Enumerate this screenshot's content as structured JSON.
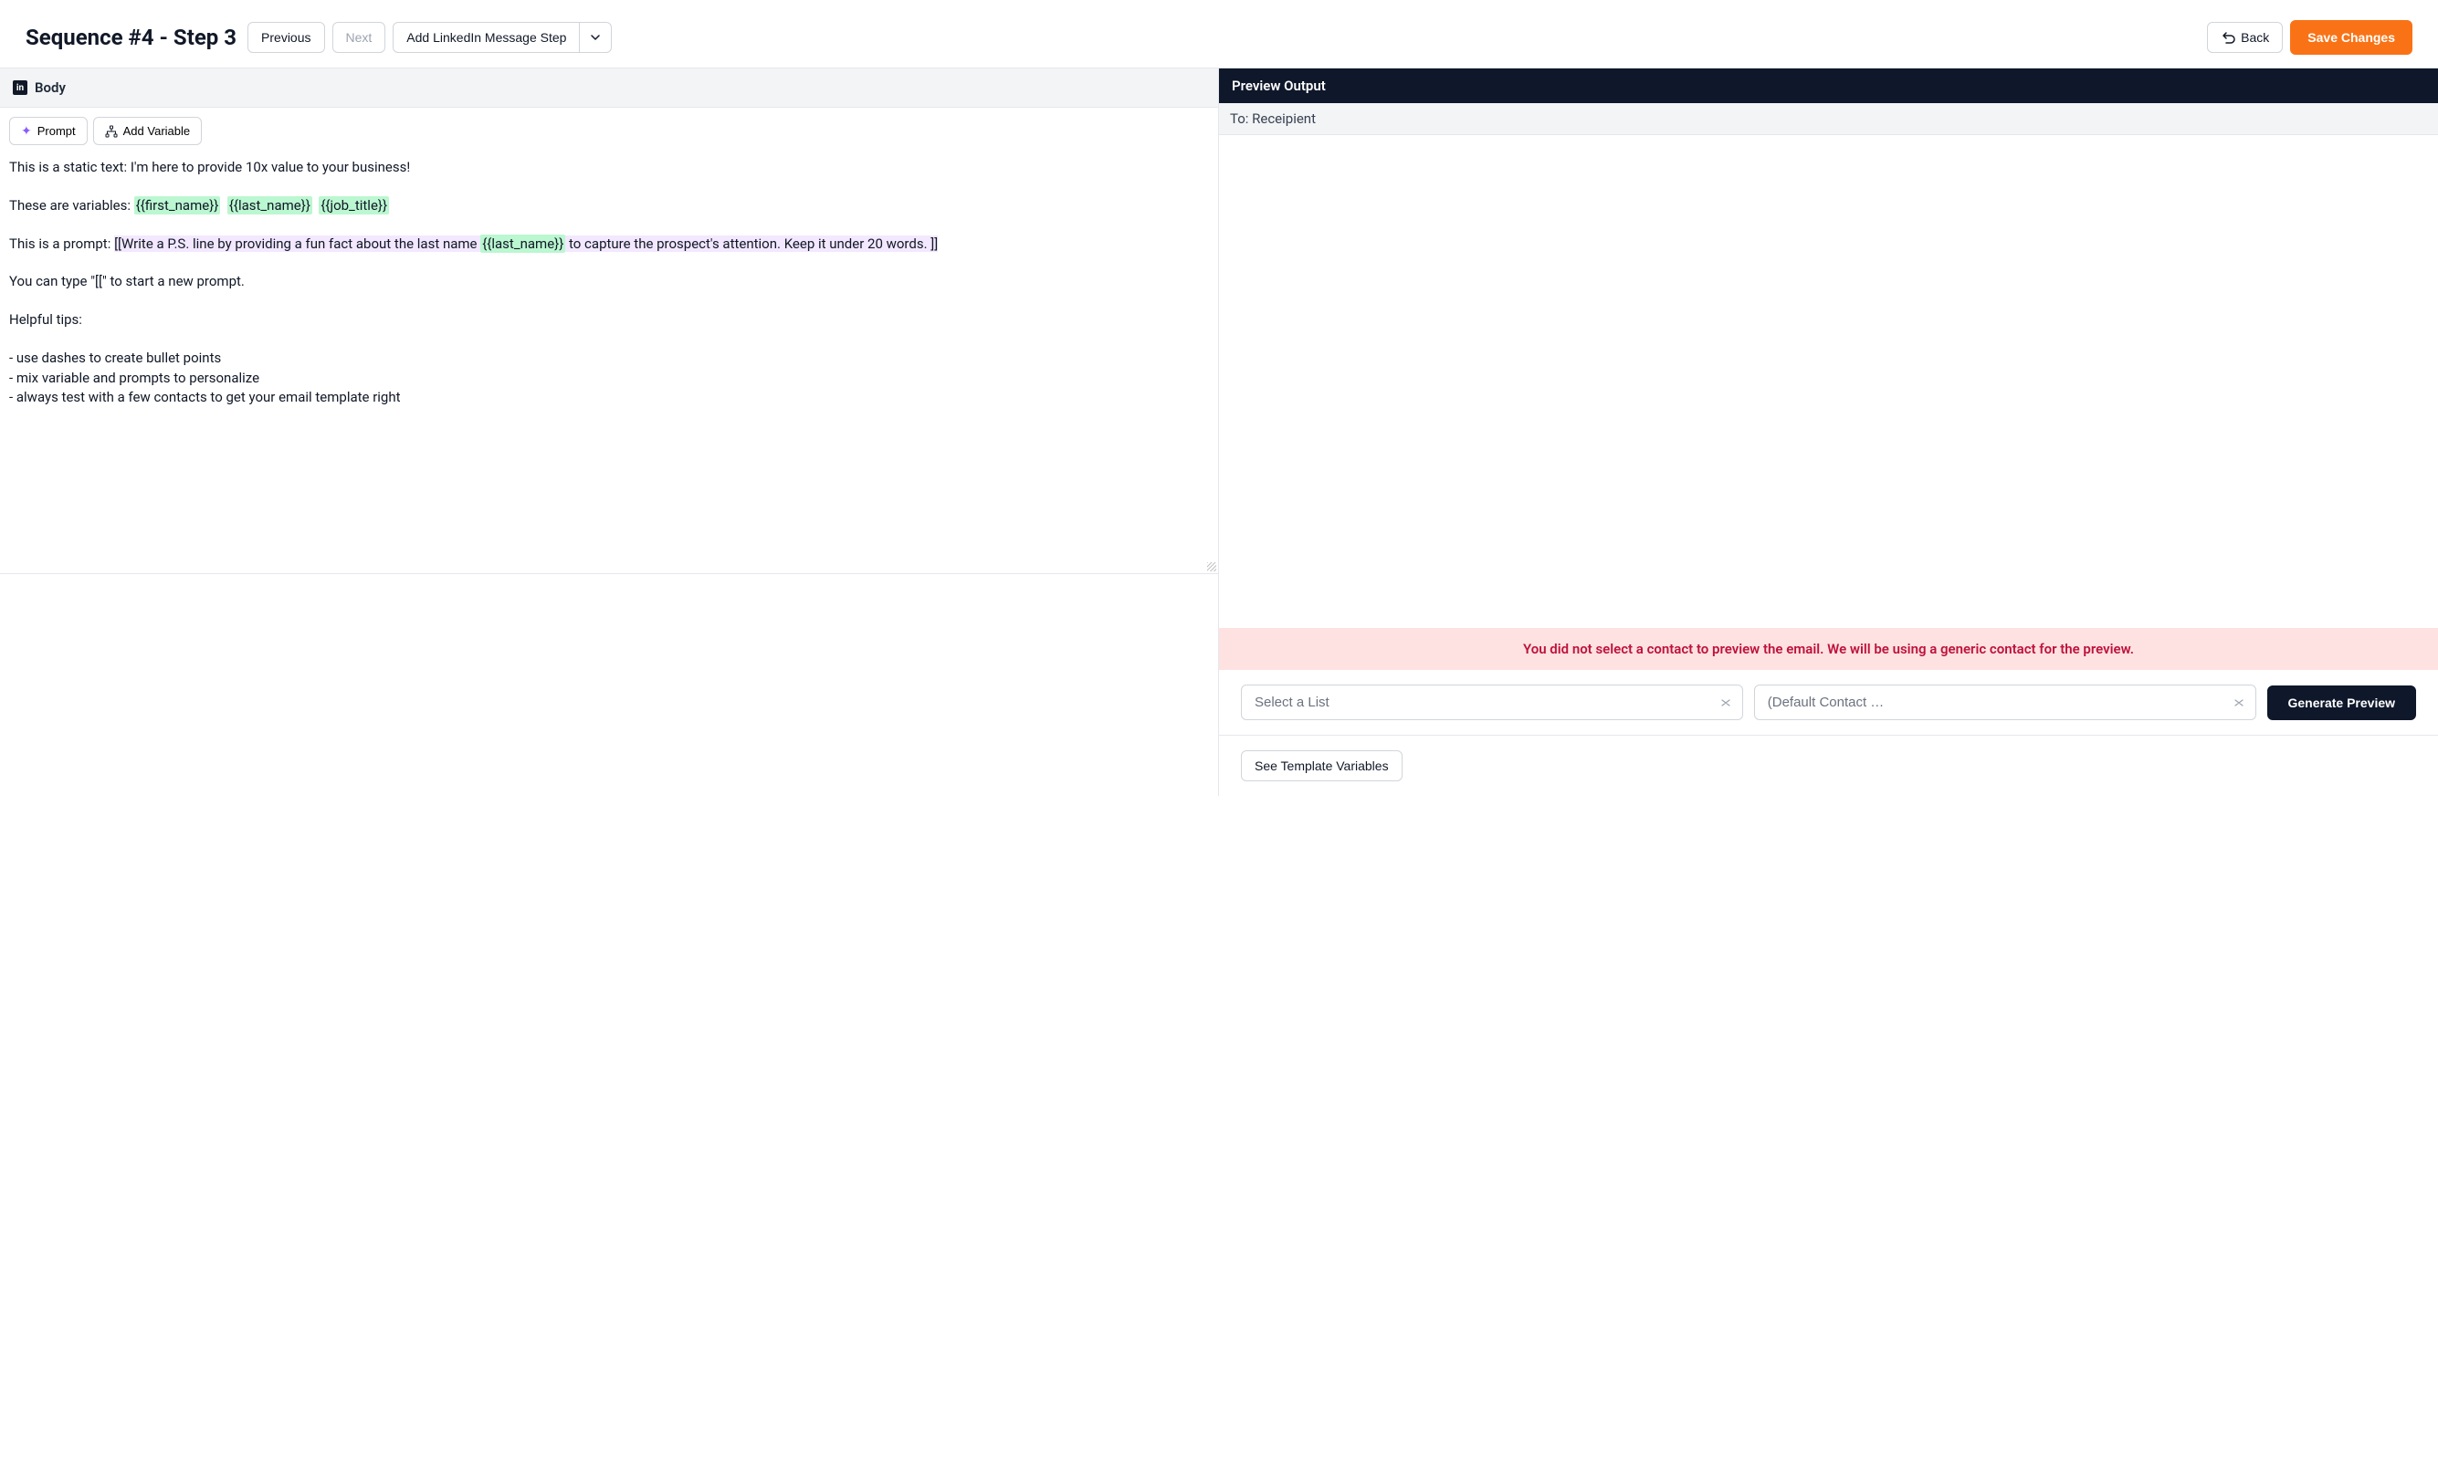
{
  "topbar": {
    "title": "Sequence #4 - Step 3",
    "previous_label": "Previous",
    "next_label": "Next",
    "add_step_label": "Add LinkedIn Message Step",
    "back_label": "Back",
    "save_label": "Save Changes"
  },
  "editor": {
    "tab_label": "Body",
    "prompt_btn": "Prompt",
    "add_variable_btn": "Add Variable",
    "line_static_prefix": "This is a static text: ",
    "line_static_text": "I'm here to provide 10x value to your business!",
    "line_vars_prefix": "These are variables: ",
    "vars": [
      "{{first_name}}",
      "{{last_name}}",
      "{{job_title}}"
    ],
    "line_prompt_prefix": "This is a prompt: ",
    "prompt_part1": "[[Write a P.S. line by providing a fun fact about the last name ",
    "prompt_var": "{{last_name}}",
    "prompt_part2": "  to capture the prospect's attention. Keep it under 20 words. ]]",
    "line_hint": "You can type \"[[\" to start a new prompt.",
    "tips_title": "Helpful tips:",
    "tip1": "- use dashes to create bullet points",
    "tip2": "- mix variable and prompts to personalize",
    "tip3": "- always test with a few contacts to get your email template right"
  },
  "preview": {
    "header": "Preview Output",
    "to_label": "To: Receipient",
    "warning": "You did not select a contact to preview the email. We will be using a generic contact for the preview.",
    "select_list_placeholder": "Select a List",
    "select_contact_placeholder": "(Default Contact …",
    "generate_label": "Generate Preview",
    "see_vars_label": "See Template Variables"
  }
}
